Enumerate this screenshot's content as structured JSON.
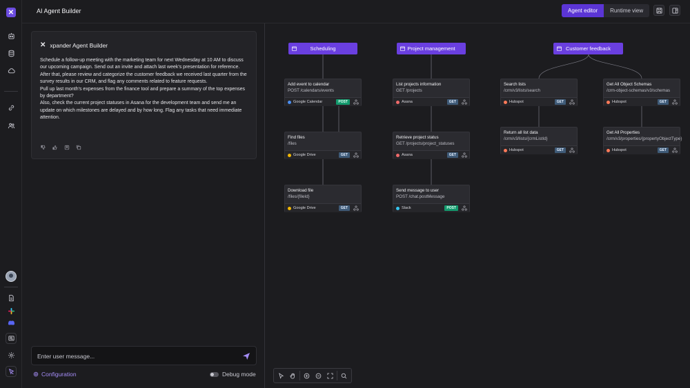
{
  "header": {
    "title": "AI Agent Builder",
    "tabs": [
      {
        "label": "Agent editor",
        "active": true
      },
      {
        "label": "Runtime view",
        "active": false
      }
    ]
  },
  "chat": {
    "agent_name": "xpander Agent Builder",
    "message": "Schedule a follow-up meeting with the marketing team for next Wednesday at 10 AM to discuss our upcoming campaign. Send out an invite and attach last week's presentation for reference. After that, please review and categorize the customer feedback we received last quarter from the survey results in our CRM, and flag any comments related to feature requests.\nPull up last month's expenses from the finance tool and prepare a summary of the top expenses by department?\nAlso, check the current project statuses in Asana for the development team and send me an update on which milestones are delayed and by how long. Flag any tasks that need immediate attention.",
    "input_placeholder": "Enter user message...",
    "configuration_label": "Configuration",
    "debug_label": "Debug mode"
  },
  "flow": {
    "groups": [
      {
        "label": "Scheduling"
      },
      {
        "label": "Project management"
      },
      {
        "label": "Customer feedback"
      }
    ],
    "nodes": {
      "add_event": {
        "title": "Add event to calendar",
        "path": "POST /calendars/events",
        "service": "Google Calendar",
        "method": "POST",
        "color": "#4a8df0"
      },
      "find_files": {
        "title": "Find files",
        "path": "/files",
        "service": "Google Drive",
        "method": "GET",
        "color": "#f2b705"
      },
      "download_file": {
        "title": "Download file",
        "path": "/files/{fileId}",
        "service": "Google Drive",
        "method": "GET",
        "color": "#f2b705"
      },
      "list_projects": {
        "title": "List projects information",
        "path": "GET /projects",
        "service": "Asana",
        "method": "GET",
        "color": "#f06a6a"
      },
      "retrieve_status": {
        "title": "Retrieve project status",
        "path": "GET /projects/project_statuses",
        "service": "Asana",
        "method": "GET",
        "color": "#f06a6a"
      },
      "send_message": {
        "title": "Send message to user",
        "path": "POST /chat.postMessage",
        "service": "Slack",
        "method": "POST",
        "color": "#36c5f0"
      },
      "search_lists": {
        "title": "Search lists",
        "path": "/crm/v3/lists/search",
        "service": "Hubspot",
        "method": "GET",
        "color": "#ff7a59"
      },
      "return_list": {
        "title": "Return all list data",
        "path": "/crm/v3/lists/{crmListId}",
        "service": "Hubspot",
        "method": "GET",
        "color": "#ff7a59"
      },
      "get_schemas": {
        "title": "Get All Object Schemas",
        "path": "/crm-object-schemas/v3/schemas",
        "service": "Hubspot",
        "method": "GET",
        "color": "#ff7a59"
      },
      "get_properties": {
        "title": "Get All Properties",
        "path": "/crm/v3/properties/{propertyObjectType}",
        "service": "Hubspot",
        "method": "GET",
        "color": "#ff7a59"
      }
    }
  },
  "colors": {
    "accent": "#5b35d5",
    "group_node": "#6a3fe0",
    "post": "#139a6d",
    "get": "#3f5b78"
  }
}
